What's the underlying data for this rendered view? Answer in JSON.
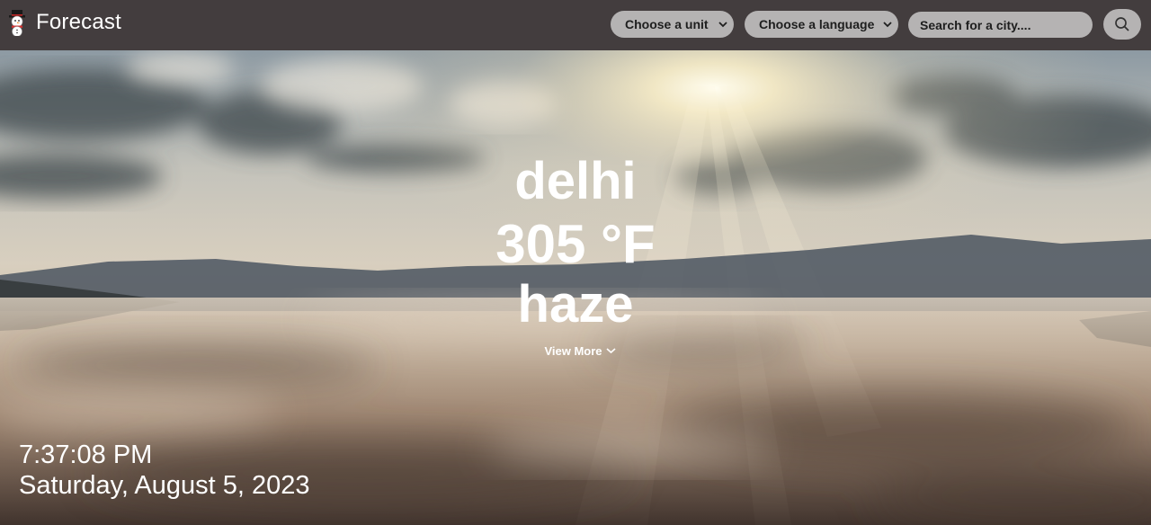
{
  "app": {
    "title": "Forecast",
    "logo_icon": "snowman-icon"
  },
  "controls": {
    "unit_select": {
      "label": "Choose a unit",
      "icon": "chevron-down-icon"
    },
    "language_select": {
      "label": "Choose a language",
      "icon": "chevron-down-icon"
    },
    "search": {
      "placeholder": "Search for a city....",
      "value": ""
    },
    "search_button_icon": "search-icon"
  },
  "weather": {
    "city": "delhi",
    "temperature": "305 °F",
    "condition": "haze",
    "view_more_label": "View More",
    "view_more_icon": "chevron-down-icon"
  },
  "clock": {
    "time": "7:37:08 PM",
    "date": "Saturday, August 5, 2023"
  },
  "colors": {
    "navbar": "#433d3e",
    "control_background": "#b5b3b3",
    "text_light": "#ffffff",
    "text_dark": "#1e1e1e"
  }
}
